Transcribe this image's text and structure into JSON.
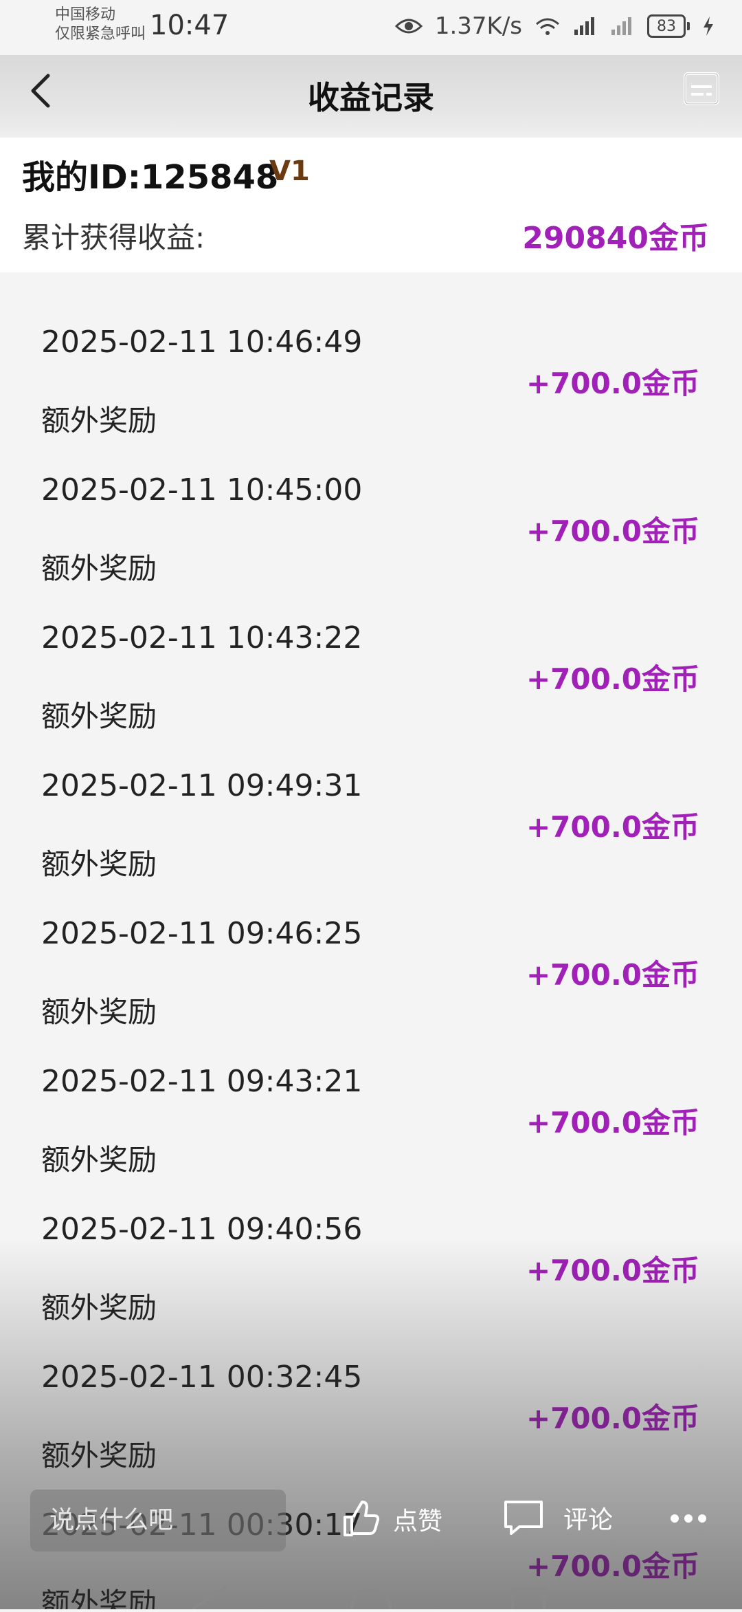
{
  "status_bar": {
    "carrier_line1": "中国移动",
    "carrier_line2": "仅限紧急呼叫",
    "time": "10:47",
    "net_speed": "1.37K/s",
    "battery": "83"
  },
  "header": {
    "title": "收益记录",
    "back_icon": "chevron-left-icon",
    "menu_icon": "list-box-icon"
  },
  "profile": {
    "id_text": "我的ID:125848",
    "level": "V1",
    "total_label": "累计获得收益:",
    "total_value": "290840金币"
  },
  "records": [
    {
      "time": "2025-02-11 10:46:49",
      "desc": "额外奖励",
      "amount": "+700.0金币"
    },
    {
      "time": "2025-02-11 10:45:00",
      "desc": "额外奖励",
      "amount": "+700.0金币"
    },
    {
      "time": "2025-02-11 10:43:22",
      "desc": "额外奖励",
      "amount": "+700.0金币"
    },
    {
      "time": "2025-02-11 09:49:31",
      "desc": "额外奖励",
      "amount": "+700.0金币"
    },
    {
      "time": "2025-02-11 09:46:25",
      "desc": "额外奖励",
      "amount": "+700.0金币"
    },
    {
      "time": "2025-02-11 09:43:21",
      "desc": "额外奖励",
      "amount": "+700.0金币"
    },
    {
      "time": "2025-02-11 09:40:56",
      "desc": "额外奖励",
      "amount": "+700.0金币"
    },
    {
      "time": "2025-02-11 00:32:45",
      "desc": "额外奖励",
      "amount": "+700.0金币"
    },
    {
      "time": "2025-02-11 00:30:17",
      "desc": "额外奖励",
      "amount": "+700.0金币"
    }
  ],
  "social": {
    "input_placeholder": "说点什么吧",
    "like_label": "点赞",
    "comment_label": "评论"
  },
  "colors": {
    "accent": "#a020b8",
    "level": "#6b3a10"
  }
}
